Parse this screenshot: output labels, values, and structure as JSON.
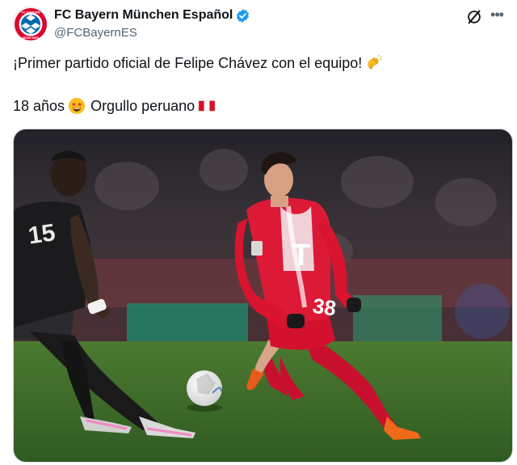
{
  "tweet": {
    "display_name": "FC Bayern München Español",
    "handle": "@FCBayernES",
    "line1": "¡Primer partido oficial de Felipe Chávez con el equipo!",
    "line2a": "18 años",
    "line2b": "Orgullo peruano",
    "avatar_text": "FC BAYERN MÜNCHEN"
  },
  "icons": {
    "verified": "verified-badge-icon",
    "grok": "grok-icon",
    "more": "more-options-icon",
    "clap": "clapping-hands-emoji",
    "star_eyes": "star-struck-emoji",
    "flag": "peru-flag-emoji"
  },
  "media": {
    "shirt_number": "38",
    "opponent_number": "15",
    "sponsor_letter": "T"
  },
  "colors": {
    "bayern_red": "#dc052d",
    "verified_blue": "#1d9bf0",
    "pitch_green": "#3f6b2b"
  }
}
